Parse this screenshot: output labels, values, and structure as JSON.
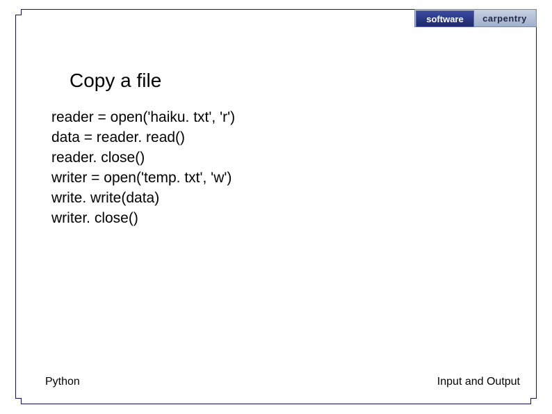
{
  "logo": {
    "left": "software",
    "right": "carpentry"
  },
  "title": "Copy a file",
  "code": {
    "l1": "reader = open('haiku. txt', 'r')",
    "l2": "data = reader. read()",
    "l3": "reader. close()",
    "l4": "writer = open('temp. txt', 'w')",
    "l5": "write. write(data)",
    "l6": "writer. close()"
  },
  "footer": {
    "left": "Python",
    "right": "Input and Output"
  }
}
